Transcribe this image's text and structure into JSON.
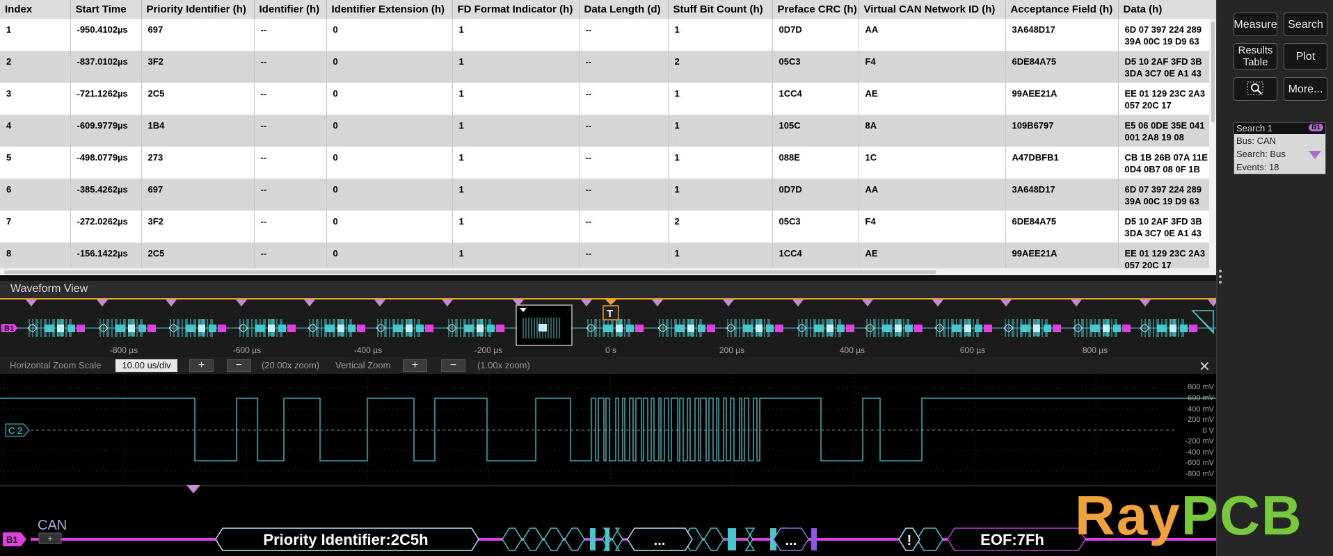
{
  "table": {
    "columns": [
      "Index",
      "Start Time",
      "Priority Identifier (h)",
      "Identifier (h)",
      "Identifier Extension (h)",
      "FD Format Indicator (h)",
      "Data Length (d)",
      "Stuff Bit Count (h)",
      "Preface CRC (h)",
      "Virtual CAN Network ID (h)",
      "Acceptance Field (h)",
      "Data (h)"
    ],
    "rows": [
      [
        "1",
        "-950.4102µs",
        "697",
        "--",
        "0",
        "1",
        "--",
        "1",
        "0D7D",
        "AA",
        "3A648D17",
        "6D 07 397 224 289",
        "39A 00C 19 D9 63"
      ],
      [
        "2",
        "-837.0102µs",
        "3F2",
        "--",
        "0",
        "1",
        "--",
        "2",
        "05C3",
        "F4",
        "6DE84A75",
        "D5 10 2AF 3FD 3B",
        "3DA 3C7 0E A1 43"
      ],
      [
        "3",
        "-721.1262µs",
        "2C5",
        "--",
        "0",
        "1",
        "--",
        "1",
        "1CC4",
        "AE",
        "99AEE21A",
        "EE 01 129 23C 2A3",
        "057 20C 17"
      ],
      [
        "4",
        "-609.9779µs",
        "1B4",
        "--",
        "0",
        "1",
        "--",
        "1",
        "105C",
        "8A",
        "109B6797",
        "E5 06 0DE 35E 041",
        "001 2A8 19 08"
      ],
      [
        "5",
        "-498.0779µs",
        "273",
        "--",
        "0",
        "1",
        "--",
        "1",
        "088E",
        "1C",
        "A47DBFB1",
        "CB 1B 26B 07A 11E",
        "0D4 0B7 08 0F 1B"
      ],
      [
        "6",
        "-385.4262µs",
        "697",
        "--",
        "0",
        "1",
        "--",
        "1",
        "0D7D",
        "AA",
        "3A648D17",
        "6D 07 397 224 289",
        "39A 00C 19 D9 63"
      ],
      [
        "7",
        "-272.0262µs",
        "3F2",
        "--",
        "0",
        "1",
        "--",
        "2",
        "05C3",
        "F4",
        "6DE84A75",
        "D5 10 2AF 3FD 3B",
        "3DA 3C7 0E A1 43"
      ],
      [
        "8",
        "-156.1422µs",
        "2C5",
        "--",
        "0",
        "1",
        "--",
        "1",
        "1CC4",
        "AE",
        "99AEE21A",
        "EE 01 129 23C 2A3",
        "057 20C 17"
      ]
    ]
  },
  "right_panel": {
    "buttons": {
      "measure": "Measure",
      "search": "Search",
      "results_table": "Results\nTable",
      "plot": "Plot",
      "more": "More..."
    },
    "search_badge": {
      "title": "Search 1",
      "bus_badge": "B1",
      "bus": "Bus: CAN",
      "search": "Search: Bus",
      "events": "Events: 18"
    }
  },
  "waveform_view": {
    "title": "Waveform View",
    "overview_ticks": [
      "-800 µs",
      "-600 µs",
      "-400 µs",
      "-200 µs",
      "0 s",
      "200 µs",
      "400 µs",
      "600 µs",
      "800 µs"
    ],
    "bus_label": "B1",
    "trigger_label": "T",
    "zoom": {
      "h_label": "Horizontal Zoom Scale",
      "h_value": "10.00 us/div",
      "plus": "+",
      "minus": "−",
      "h_factor": "(20.00x zoom)",
      "v_label": "Vertical Zoom",
      "v_factor": "(1.00x zoom)",
      "close": "✕"
    },
    "channel_label": "C 2",
    "v_axis_labels": [
      "800 mV",
      "600 mV",
      "400 mV",
      "200 mV",
      "0 V",
      "-200 mV",
      "-400 mV",
      "-600 mV",
      "-800 mV"
    ],
    "bus_name": "CAN",
    "bus_plus": "+",
    "decode": {
      "priority": "Priority Identifier:2C5h",
      "dots1": "...",
      "dots2": "...",
      "bang": "!",
      "eof": "EOF:7Fh"
    }
  },
  "watermark": {
    "part1": "Ray",
    "part2": "PCB"
  },
  "colors": {
    "trace": "#47c8cc",
    "bus": "#e040e0",
    "marker": "#c888d8",
    "trigger": "#f0a030"
  }
}
